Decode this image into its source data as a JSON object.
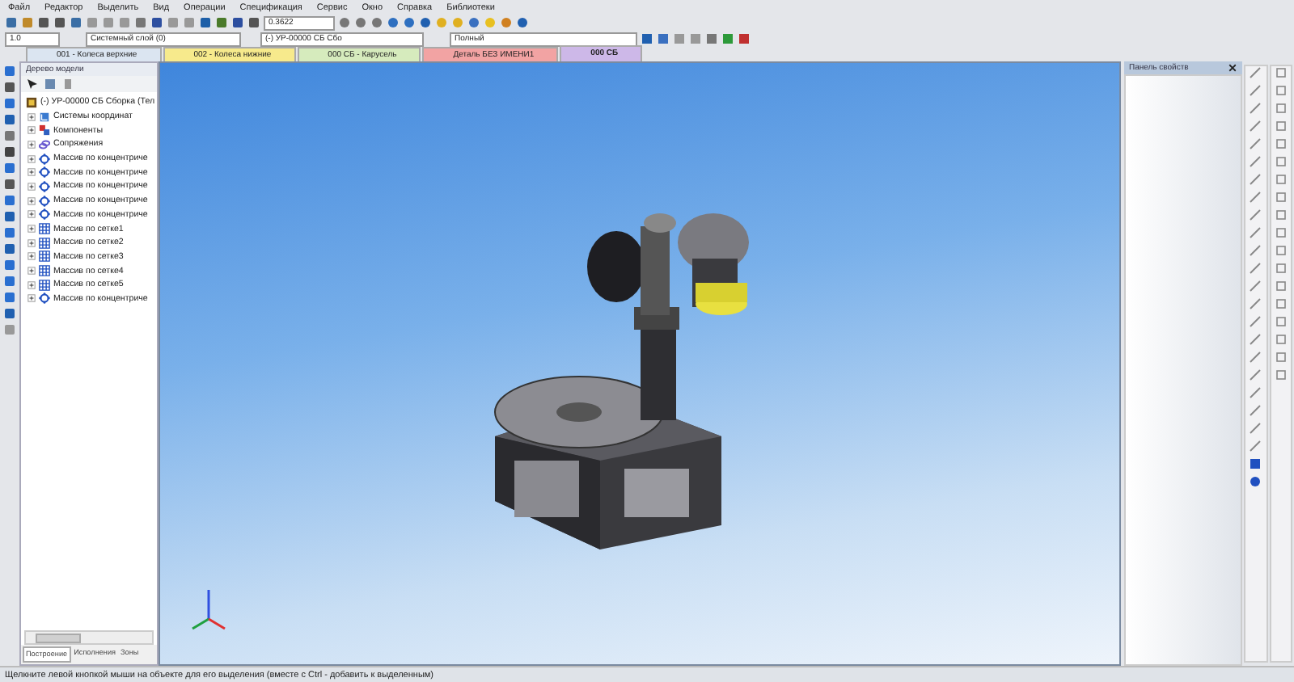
{
  "menu": [
    "Файл",
    "Редактор",
    "Выделить",
    "Вид",
    "Операции",
    "Спецификация",
    "Сервис",
    "Окно",
    "Справка",
    "Библиотеки"
  ],
  "toolbar": {
    "zoom": "0.3622",
    "step": "1.0",
    "layer": "Системный слой (0)",
    "component": "(-) УР-00000 СБ Сбо",
    "style": "Полный"
  },
  "tabs": [
    {
      "label": "001 - Колеса верхние",
      "color": "#dbe5f1",
      "selected": false
    },
    {
      "label": "002 - Колеса нижние",
      "color": "#f7ea8c",
      "selected": false
    },
    {
      "label": "000 СБ - Карусель",
      "color": "#d6ebbd",
      "selected": false
    },
    {
      "label": "Деталь БЕЗ ИМЕНИ1",
      "color": "#f2a3a3",
      "selected": false
    },
    {
      "label": "000 СБ",
      "color": "#cdb8e8",
      "selected": true
    }
  ],
  "tree_panel": {
    "title": "Дерево модели",
    "root": {
      "label": "(-) УР-00000 СБ Сборка (Тел",
      "children": [
        {
          "label": "Системы координат",
          "kind": "coords"
        },
        {
          "label": "Компоненты",
          "kind": "components"
        },
        {
          "label": "Сопряжения",
          "kind": "mates"
        },
        {
          "label": "Массив по концентриче",
          "kind": "circular"
        },
        {
          "label": "Массив по концентриче",
          "kind": "circular"
        },
        {
          "label": "Массив по концентриче",
          "kind": "circular"
        },
        {
          "label": "Массив по концентриче",
          "kind": "circular"
        },
        {
          "label": "Массив по концентриче",
          "kind": "circular"
        },
        {
          "label": "Массив по сетке1",
          "kind": "grid"
        },
        {
          "label": "Массив по сетке2",
          "kind": "grid"
        },
        {
          "label": "Массив по сетке3",
          "kind": "grid"
        },
        {
          "label": "Массив по сетке4",
          "kind": "grid"
        },
        {
          "label": "Массив по сетке5",
          "kind": "grid"
        },
        {
          "label": "Массив по концентриче",
          "kind": "circular"
        }
      ]
    },
    "tabs": [
      {
        "label": "Построение",
        "selected": true
      },
      {
        "label": "Исполнения",
        "selected": false
      },
      {
        "label": "Зоны",
        "selected": false
      }
    ]
  },
  "properties_panel": {
    "title": "Панель свойств"
  },
  "status_bar": "Щелкните левой кнопкой мыши на объекте для его выделения (вместе с Ctrl - добавить к выделенным)"
}
